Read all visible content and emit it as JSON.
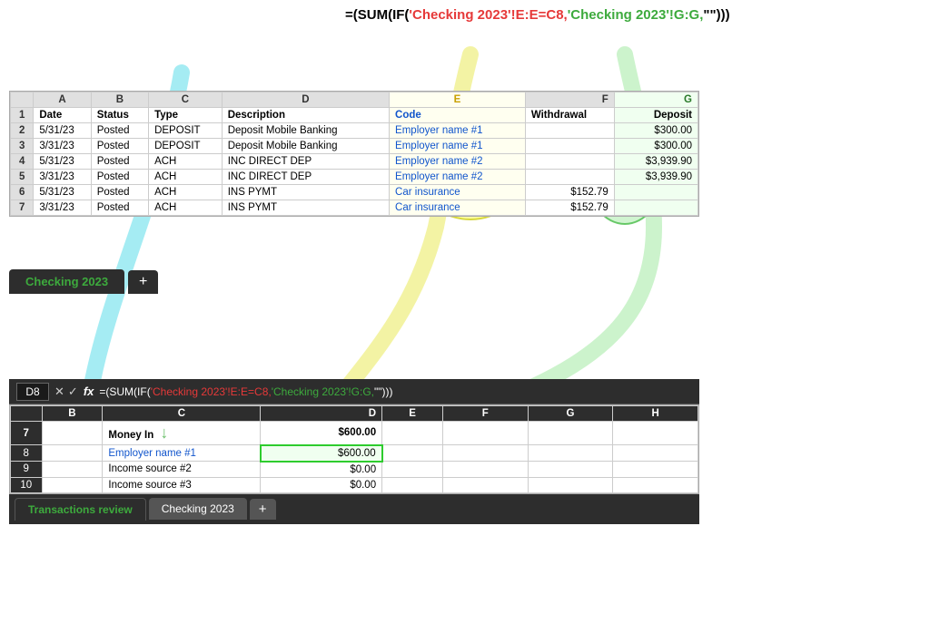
{
  "formula_top": {
    "full": "=(SUM(IF('Checking 2023'!E:E=C8,'Checking 2023'!G:G,\"\")))",
    "prefix": "=(SUM(IF(",
    "ref1": "'Checking 2023'!E:E=C8,",
    "ref2": "'Checking 2023'!G:G,",
    "suffix": "\"\")))  "
  },
  "top_sheet": {
    "columns": [
      "A",
      "B",
      "C",
      "D",
      "E",
      "F",
      "G"
    ],
    "headers": {
      "A": "Date",
      "B": "Status",
      "C": "Type",
      "D": "Description",
      "E": "Code",
      "F": "Withdrawal",
      "G": "Deposit"
    },
    "rows": [
      {
        "num": "2",
        "A": "5/31/23",
        "B": "Posted",
        "C": "DEPOSIT",
        "D": "Deposit Mobile Banking",
        "E": "Employer name #1",
        "F": "",
        "G": "$300.00"
      },
      {
        "num": "3",
        "A": "3/31/23",
        "B": "Posted",
        "C": "DEPOSIT",
        "D": "Deposit Mobile Banking",
        "E": "Employer name #1",
        "F": "",
        "G": "$300.00"
      },
      {
        "num": "4",
        "A": "5/31/23",
        "B": "Posted",
        "C": "ACH",
        "D": "INC DIRECT DEP",
        "E": "Employer name #2",
        "F": "",
        "G": "$3,939.90"
      },
      {
        "num": "5",
        "A": "3/31/23",
        "B": "Posted",
        "C": "ACH",
        "D": "INC DIRECT DEP",
        "E": "Employer name #2",
        "F": "",
        "G": "$3,939.90"
      },
      {
        "num": "6",
        "A": "5/31/23",
        "B": "Posted",
        "C": "ACH",
        "D": "INS PYMT",
        "E": "Car insurance",
        "F": "$152.79",
        "G": ""
      },
      {
        "num": "7",
        "A": "3/31/23",
        "B": "Posted",
        "C": "ACH",
        "D": "INS PYMT",
        "E": "Car insurance",
        "F": "$152.79",
        "G": ""
      }
    ]
  },
  "top_tab": {
    "active_label": "Checking 2023",
    "add_label": "+"
  },
  "bottom_formula_bar": {
    "cell_ref": "D8",
    "fx_label": "fx",
    "formula_prefix": "=(SUM(IF(",
    "formula_ref1": "'Checking 2023'!E:E=C8,",
    "formula_ref2": "'Checking 2023'!G:G,",
    "formula_suffix": "\"\")))  "
  },
  "bottom_sheet": {
    "columns": [
      "B",
      "C",
      "D",
      "E",
      "F",
      "G",
      "H"
    ],
    "rows": [
      {
        "num": "7",
        "B": "",
        "C": "Money In",
        "D": "$600.00",
        "E": "",
        "F": "",
        "G": "",
        "H": "",
        "bold": true
      },
      {
        "num": "8",
        "B": "",
        "C": "Employer name #1",
        "D": "$600.00",
        "E": "",
        "F": "",
        "G": "",
        "H": "",
        "selected_d": true,
        "link_c": true
      },
      {
        "num": "9",
        "B": "",
        "C": "Income source #2",
        "D": "$0.00",
        "E": "",
        "F": "",
        "G": "",
        "H": ""
      },
      {
        "num": "10",
        "B": "",
        "C": "Income source #3",
        "D": "$0.00",
        "E": "",
        "F": "",
        "G": "",
        "H": ""
      }
    ]
  },
  "bottom_tabs": {
    "tab1_label": "Transactions review",
    "tab2_label": "Checking 2023",
    "add_label": "+"
  },
  "icons": {
    "arrow_up": "▲",
    "arrow_down": "▼",
    "cross": "✕",
    "check": "✓",
    "arrow_down_indicator": "↓"
  }
}
